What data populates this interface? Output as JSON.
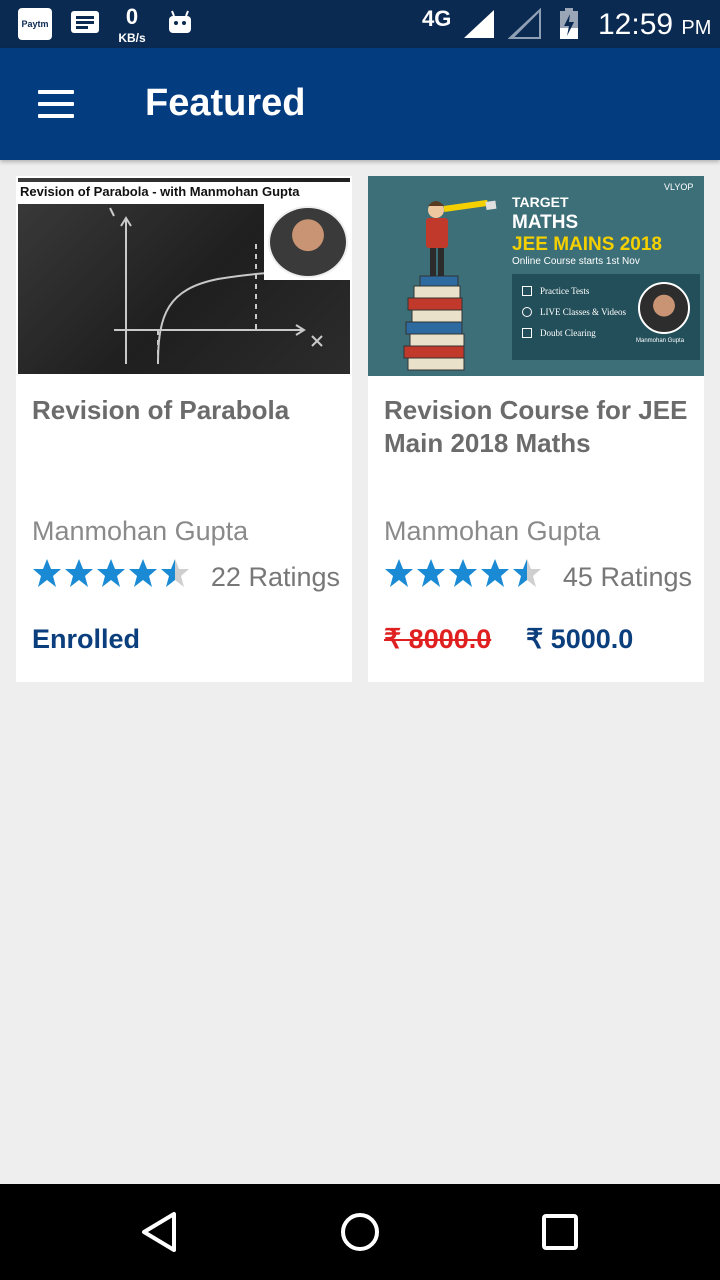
{
  "status_bar": {
    "paytm_label": "Paytm",
    "speed_value": "0",
    "speed_unit": "KB/s",
    "network": "4G",
    "time": "12:59",
    "ampm": "PM"
  },
  "app_bar": {
    "title": "Featured",
    "menu_icon": "hamburger-menu-icon"
  },
  "courses": [
    {
      "thumbnail_caption": "Revision of Parabola - with Manmohan Gupta",
      "title": "Revision of Parabola",
      "author": "Manmohan Gupta",
      "rating": 4.5,
      "ratings_text": "22 Ratings",
      "status": "Enrolled"
    },
    {
      "thumbnail": {
        "logo": "VLYOP",
        "line1": "TARGET",
        "line2": "MATHS",
        "line3": "JEE MAINS 2018",
        "line4": "Online Course starts 1st Nov",
        "features": [
          "Practice Tests",
          "LIVE Classes & Videos",
          "Doubt Clearing"
        ],
        "presenter": "Manmohan Gupta"
      },
      "title": "Revision Course for JEE Main 2018 Maths",
      "author": "Manmohan Gupta",
      "rating": 4.5,
      "ratings_text": "45 Ratings",
      "price_original": "₹ 8000.0",
      "price_current": "₹ 5000.0"
    }
  ],
  "colors": {
    "status_bar": "#0b2a52",
    "app_bar": "#043c80",
    "star": "#1a8ad4",
    "star_empty": "#cfcfcf",
    "price_old": "#e02020",
    "accent_text": "#0b3e7c"
  },
  "nav_bar": {
    "icons": [
      "back-triangle-icon",
      "home-circle-icon",
      "recents-square-icon"
    ]
  }
}
